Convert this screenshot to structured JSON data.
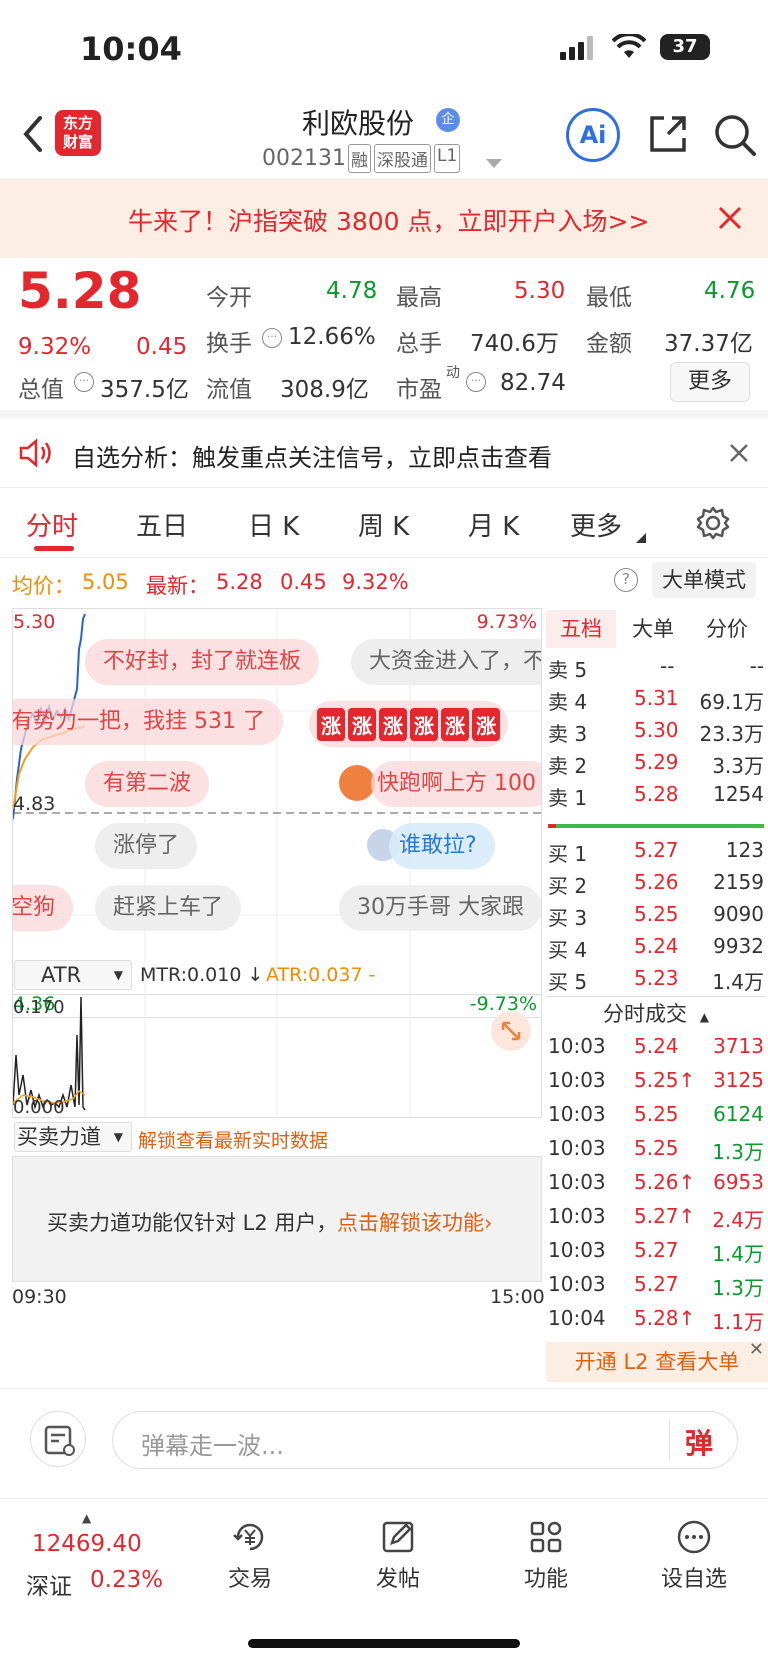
{
  "status": {
    "time": "10:04",
    "battery": "37"
  },
  "header": {
    "logo_text": "东方财富",
    "stock_name": "利欧股份",
    "badge": "企",
    "code": "002131",
    "tags": [
      "融",
      "深股通",
      "L1"
    ],
    "ai_label": "Ai"
  },
  "banner": {
    "text": "牛来了！沪指突破 3800 点，立即开户入场>>"
  },
  "quote": {
    "price": "5.28",
    "change_pct": "9.32%",
    "change": "0.45",
    "open_label": "今开",
    "open": "4.78",
    "high_label": "最高",
    "high": "5.30",
    "low_label": "最低",
    "low": "4.76",
    "turnover_label": "换手",
    "turnover": "12.66%",
    "volume_label": "总手",
    "volume": "740.6万",
    "amount_label": "金额",
    "amount": "37.37亿",
    "mktcap_label": "总值",
    "mktcap": "357.5亿",
    "float_label": "流值",
    "float": "308.9亿",
    "pe_label": "市盈",
    "pe_sup": "动",
    "pe": "82.74",
    "more": "更多"
  },
  "notice": {
    "text": "自选分析：触发重点关注信号，立即点击查看"
  },
  "tabs": [
    "分时",
    "五日",
    "日 K",
    "周 K",
    "月 K",
    "更多"
  ],
  "chart": {
    "avg_label": "均价：",
    "avg": "5.05",
    "latest_label": "最新：",
    "latest": "5.28",
    "latest_chg": "0.45",
    "latest_pct": "9.32%",
    "mode_btn": "大单模式",
    "y_top": "5.30",
    "y_mid": "4.83",
    "y_bot": "4.36",
    "pct_top": "9.73%",
    "pct_bot": "-9.73%",
    "x_start": "09:30",
    "x_end": "15:00",
    "indicator": "ATR",
    "mtr": "MTR:0.010 ↓",
    "atr": "ATR:0.037 -",
    "ind_top": "0.170",
    "ind_bot": "0.000",
    "sub_indicator": "买卖力道",
    "unlock_link": "解锁查看最新实时数据",
    "l2_msg": "买卖力道功能仅针对 L2 用户，",
    "l2_link": "点击解锁该功能›"
  },
  "danmaku": [
    {
      "text": "不好封，封了就连板"
    },
    {
      "text": "大资金进入了，不"
    },
    {
      "text": "有势力一把，我挂 531 了"
    },
    {
      "text": "有第二波"
    },
    {
      "text": "快跑啊上方 100"
    },
    {
      "text": "涨停了"
    },
    {
      "text": "谁敢拉?"
    },
    {
      "text": "空狗"
    },
    {
      "text": "赶紧上车了"
    },
    {
      "text": "30万手哥 大家跟"
    }
  ],
  "zhang_tag": "涨",
  "orderbook": {
    "tabs": [
      "五档",
      "大单",
      "分价"
    ],
    "asks": [
      {
        "label": "卖 5",
        "price": "--",
        "vol": "--"
      },
      {
        "label": "卖 4",
        "price": "5.31",
        "vol": "69.1万"
      },
      {
        "label": "卖 3",
        "price": "5.30",
        "vol": "23.3万"
      },
      {
        "label": "卖 2",
        "price": "5.29",
        "vol": "3.3万"
      },
      {
        "label": "卖 1",
        "price": "5.28",
        "vol": "1254"
      }
    ],
    "bids": [
      {
        "label": "买 1",
        "price": "5.27",
        "vol": "123"
      },
      {
        "label": "买 2",
        "price": "5.26",
        "vol": "2159"
      },
      {
        "label": "买 3",
        "price": "5.25",
        "vol": "9090"
      },
      {
        "label": "买 4",
        "price": "5.24",
        "vol": "9932"
      },
      {
        "label": "买 5",
        "price": "5.23",
        "vol": "1.4万"
      }
    ]
  },
  "trades": {
    "title": "分时成交",
    "rows": [
      {
        "time": "10:03",
        "price": "5.24",
        "vol": "3713",
        "color": "red"
      },
      {
        "time": "10:03",
        "price": "5.25↑",
        "vol": "3125",
        "color": "red"
      },
      {
        "time": "10:03",
        "price": "5.25",
        "vol": "6124",
        "color": "green"
      },
      {
        "time": "10:03",
        "price": "5.25",
        "vol": "1.3万",
        "color": "green"
      },
      {
        "time": "10:03",
        "price": "5.26↑",
        "vol": "6953",
        "color": "red"
      },
      {
        "time": "10:03",
        "price": "5.27↑",
        "vol": "2.4万",
        "color": "red"
      },
      {
        "time": "10:03",
        "price": "5.27",
        "vol": "1.4万",
        "color": "green"
      },
      {
        "time": "10:03",
        "price": "5.27",
        "vol": "1.3万",
        "color": "green"
      },
      {
        "time": "10:04",
        "price": "5.28↑",
        "vol": "1.1万",
        "color": "red"
      }
    ],
    "l2_banner": "开通 L2 查看大单"
  },
  "input": {
    "placeholder": "弹幕走一波...",
    "send": "弹"
  },
  "bottom": {
    "index_value": "12469.40",
    "index_name": "深证",
    "index_pct": "0.23%",
    "nav": [
      "交易",
      "发帖",
      "功能",
      "设自选"
    ]
  }
}
